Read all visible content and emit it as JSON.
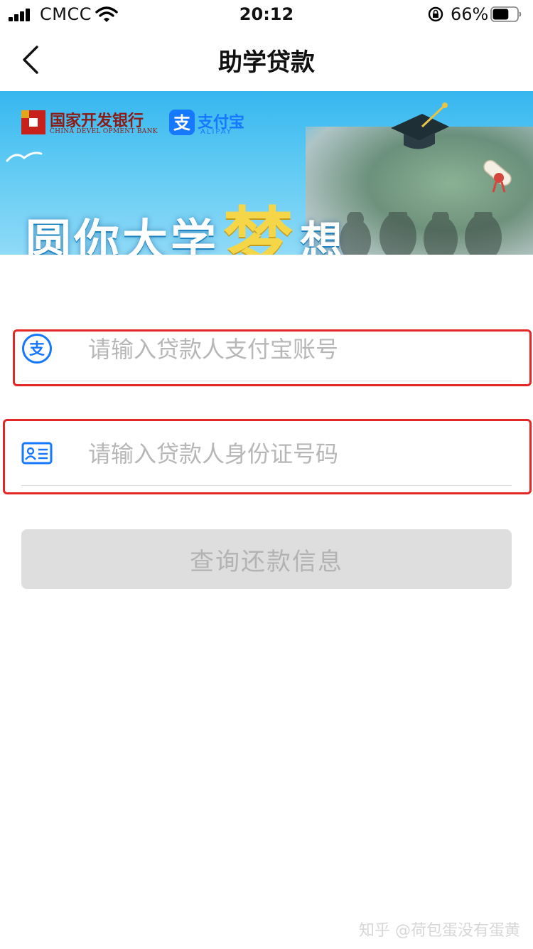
{
  "status_bar": {
    "carrier": "CMCC",
    "time": "20:12",
    "battery_percent": "66%",
    "battery_level": 0.66
  },
  "nav": {
    "title": "助学贷款"
  },
  "banner": {
    "bank_name": "国家开发银行",
    "bank_name_en": "CHINA DEVEL OPMENT BANK",
    "alipay_cn": "支付宝",
    "alipay_en": "ALIPAY",
    "slogan_prefix": "圆你大学",
    "slogan_big": "梦",
    "slogan_suffix": "想"
  },
  "form": {
    "alipay_account_placeholder": "请输入贷款人支付宝账号",
    "id_number_placeholder": "请输入贷款人身份证号码",
    "query_button_label": "查询还款信息"
  },
  "watermark": "知乎 @荷包蛋没有蛋黄",
  "colors": {
    "accent": "#1677ff",
    "highlight_border": "#e32626",
    "button_disabled_bg": "#dedede"
  }
}
